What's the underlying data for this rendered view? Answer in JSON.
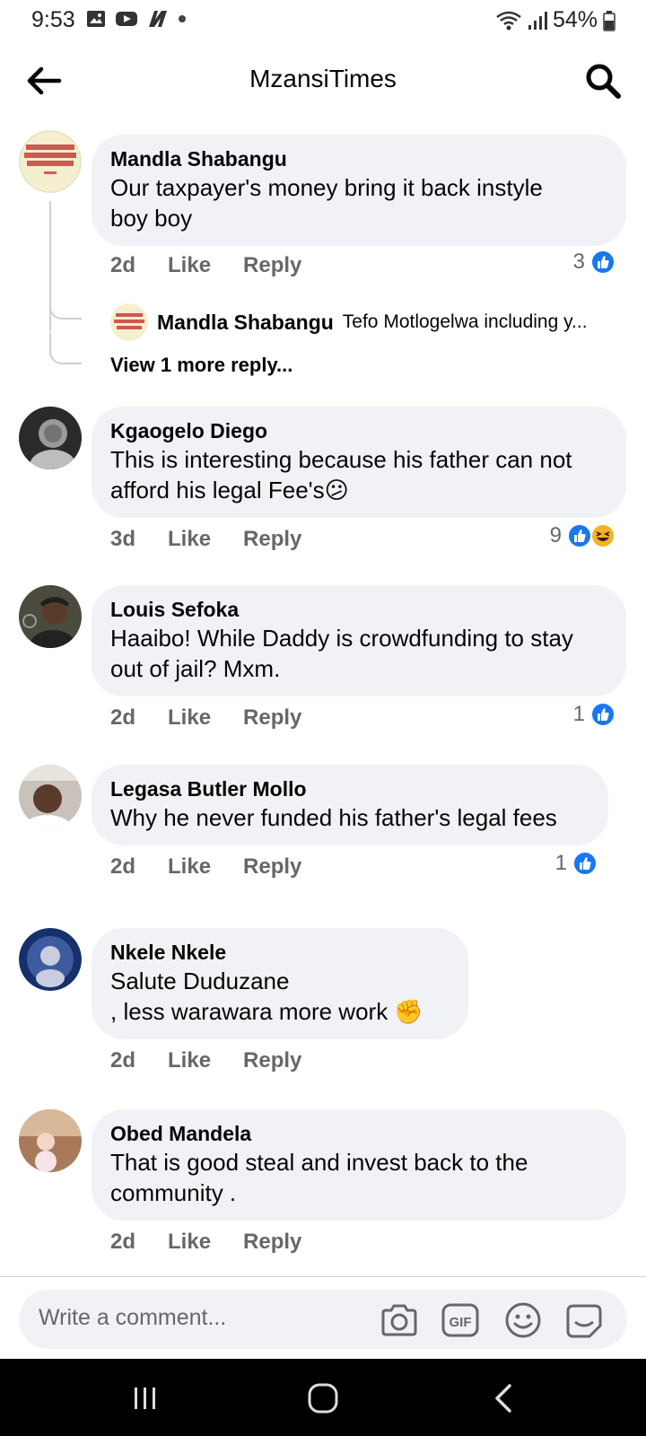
{
  "status": {
    "time": "9:53",
    "battery": "54%"
  },
  "header": {
    "title": "MzansiTimes"
  },
  "comments": [
    {
      "name": "Mandla Shabangu",
      "text": "Our taxpayer's money bring it back instyle\nboy boy",
      "age": "2d",
      "like": "Like",
      "reply": "Reply",
      "reaction_count": "3",
      "avatar_text": "NG LIVE THE ROS THAT GREW FROM THE CONCRETE TUPAC",
      "reply_preview": {
        "name": "Mandla Shabangu",
        "text": "Tefo Motlogelwa including y..."
      },
      "more_replies": "View 1 more reply..."
    },
    {
      "name": "Kgaogelo Diego",
      "text": "This is interesting because his father can not\nafford his legal Fee's😕",
      "age": "3d",
      "like": "Like",
      "reply": "Reply",
      "reaction_count": "9"
    },
    {
      "name": "Louis Sefoka",
      "text": "Haaibo! While Daddy is crowdfunding to stay\nout of jail? Mxm.",
      "age": "2d",
      "like": "Like",
      "reply": "Reply",
      "reaction_count": "1"
    },
    {
      "name": "Legasa Butler Mollo",
      "text": "Why he never funded his father's legal fees",
      "age": "2d",
      "like": "Like",
      "reply": "Reply",
      "reaction_count": "1"
    },
    {
      "name": "Nkele Nkele",
      "text": "Salute Duduzane\n, less warawara more work ✊",
      "age": "2d",
      "like": "Like",
      "reply": "Reply"
    },
    {
      "name": "Obed Mandela",
      "text": "That is good steal and invest back to the\ncommunity .",
      "age": "2d",
      "like": "Like",
      "reply": "Reply"
    }
  ],
  "composer": {
    "placeholder": "Write a comment..."
  },
  "colors": {
    "bubble": "#f0f2f5",
    "like_blue": "#1877f2",
    "secondary_text": "#65676b"
  }
}
